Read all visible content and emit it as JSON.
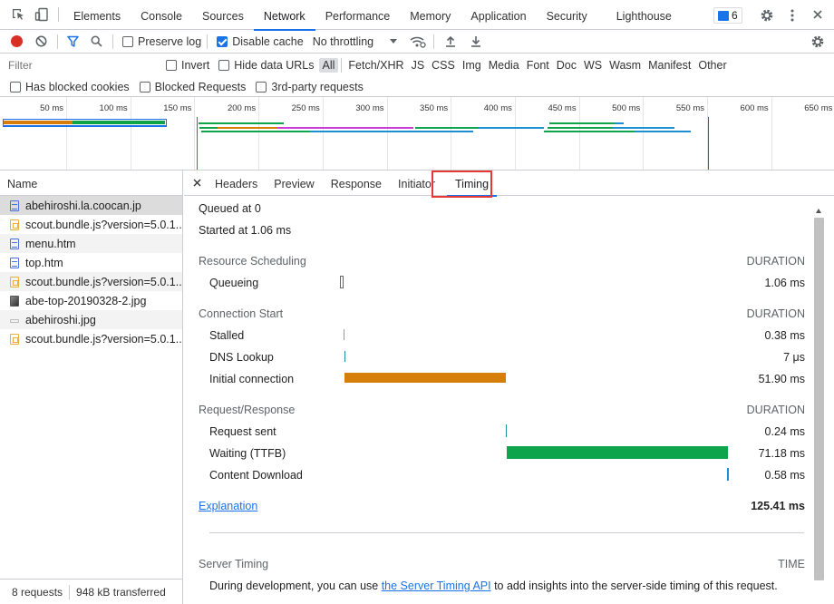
{
  "main_tabs": [
    "Elements",
    "Console",
    "Sources",
    "Network",
    "Performance",
    "Memory",
    "Application",
    "Security",
    "Lighthouse"
  ],
  "active_main_tab": "Network",
  "messages_badge": "6",
  "toolbar": {
    "preserve_log": "Preserve log",
    "disable_cache": "Disable cache",
    "throttling": "No throttling"
  },
  "filter": {
    "placeholder": "Filter",
    "invert": "Invert",
    "hide_data_urls": "Hide data URLs",
    "types": [
      "All",
      "Fetch/XHR",
      "JS",
      "CSS",
      "Img",
      "Media",
      "Font",
      "Doc",
      "WS",
      "Wasm",
      "Manifest",
      "Other"
    ],
    "has_blocked_cookies": "Has blocked cookies",
    "blocked_requests": "Blocked Requests",
    "third_party": "3rd-party requests"
  },
  "overview_ticks": [
    "50 ms",
    "100 ms",
    "150 ms",
    "200 ms",
    "250 ms",
    "300 ms",
    "350 ms",
    "400 ms",
    "450 ms",
    "500 ms",
    "550 ms",
    "600 ms",
    "650 ms"
  ],
  "colors": {
    "accent": "#1a73e8",
    "record": "#d93025",
    "connection": "#d57f0a",
    "ttfb": "#0ea44b",
    "download": "#1c8fd0",
    "highlight": "#e53935"
  },
  "requests": {
    "header": "Name",
    "items": [
      {
        "name": "abehiroshi.la.coocan.jp",
        "icon": "doc"
      },
      {
        "name": "scout.bundle.js?version=5.0.1...",
        "icon": "js"
      },
      {
        "name": "menu.htm",
        "icon": "doc"
      },
      {
        "name": "top.htm",
        "icon": "doc"
      },
      {
        "name": "scout.bundle.js?version=5.0.1...",
        "icon": "js"
      },
      {
        "name": "abe-top-20190328-2.jpg",
        "icon": "img"
      },
      {
        "name": "abehiroshi.jpg",
        "icon": "imgb"
      },
      {
        "name": "scout.bundle.js?version=5.0.1...",
        "icon": "js"
      }
    ],
    "status_count": "8 requests",
    "status_transferred": "948 kB transferred"
  },
  "detail_tabs": [
    "Headers",
    "Preview",
    "Response",
    "Initiator",
    "Timing"
  ],
  "active_detail_tab": "Timing",
  "timing": {
    "queued_at": "Queued at 0",
    "started_at": "Started at 1.06 ms",
    "duration_label": "DURATION",
    "sections": [
      {
        "title": "Resource Scheduling",
        "rows": [
          {
            "label": "Queueing",
            "value": "1.06 ms"
          }
        ]
      },
      {
        "title": "Connection Start",
        "rows": [
          {
            "label": "Stalled",
            "value": "0.38 ms"
          },
          {
            "label": "DNS Lookup",
            "value": "7 μs"
          },
          {
            "label": "Initial connection",
            "value": "51.90 ms"
          }
        ]
      },
      {
        "title": "Request/Response",
        "rows": [
          {
            "label": "Request sent",
            "value": "0.24 ms"
          },
          {
            "label": "Waiting (TTFB)",
            "value": "71.18 ms"
          },
          {
            "label": "Content Download",
            "value": "0.58 ms"
          }
        ]
      }
    ],
    "explanation": "Explanation",
    "total": "125.41 ms",
    "server_timing_title": "Server Timing",
    "server_timing_time": "TIME",
    "server_text_before": "During development, you can use ",
    "server_link": "the Server Timing API",
    "server_text_after": " to add insights into the server-side timing of this request."
  }
}
